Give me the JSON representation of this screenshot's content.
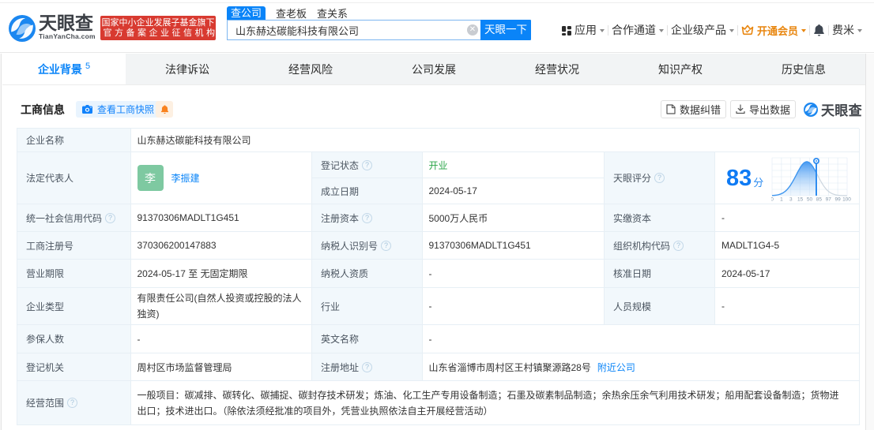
{
  "brand": {
    "name": "天眼查",
    "domain": "TianYanCha.com",
    "badge_line1": "国家中小企业发展子基金旗下",
    "badge_line2": "官方备案企业征信机构",
    "colors": {
      "blue": "#0a84f8",
      "red": "#d83a30",
      "orange": "#e8860f",
      "green": "#2aa548"
    }
  },
  "search": {
    "tab_company": "查公司",
    "tab_boss": "查老板",
    "tab_relation": "查关系",
    "value": "山东赫达碳能科技有限公司",
    "button": "天眼一下"
  },
  "nav": {
    "apps": "应用",
    "partner": "合作通道",
    "enterprise": "企业级产品",
    "vip": "开通会员",
    "user": "费米"
  },
  "tabs": {
    "t0": {
      "label": "企业背景",
      "count": "5"
    },
    "t1": {
      "label": "法律诉讼"
    },
    "t2": {
      "label": "经营风险"
    },
    "t3": {
      "label": "公司发展"
    },
    "t4": {
      "label": "经营状况"
    },
    "t5": {
      "label": "知识产权"
    },
    "t6": {
      "label": "历史信息"
    }
  },
  "section": {
    "title": "工商信息",
    "snapshot": "查看工商快照",
    "correct": "数据纠错",
    "export": "导出数据",
    "watermark": "天眼查"
  },
  "table": {
    "r1": {
      "label": "企业名称",
      "value": "山东赫达碳能科技有限公司"
    },
    "r2": {
      "label": "法定代表人",
      "avatar": "李",
      "person": "李振建",
      "c1_label": "登记状态",
      "c1_value": "开业",
      "c2_label": "成立日期",
      "c2_value": "2024-05-17",
      "score_label": "天眼评分",
      "score": "83",
      "score_unit": "分"
    },
    "r3": {
      "l1": "统一社会信用代码",
      "v1": "91370306MADLT1G451",
      "l2": "注册资本",
      "v2": "5000万人民币",
      "l3": "实缴资本",
      "v3": "-"
    },
    "r4": {
      "l1": "工商注册号",
      "v1": "370306200147883",
      "l2": "纳税人识别号",
      "v2": "91370306MADLT1G451",
      "l3": "组织机构代码",
      "v3": "MADLT1G4-5"
    },
    "r5": {
      "l1": "营业期限",
      "v1": "2024-05-17 至 无固定期限",
      "l2": "纳税人资质",
      "v2": "-",
      "l3": "核准日期",
      "v3": "2024-05-17"
    },
    "r6": {
      "l1": "企业类型",
      "v1": "有限责任公司(自然人投资或控股的法人独资)",
      "l2": "行业",
      "v2": "-",
      "l3": "人员规模",
      "v3": "-"
    },
    "r7": {
      "l1": "参保人数",
      "v1": "-",
      "l2": "英文名称",
      "v2": "-"
    },
    "r8": {
      "l1": "登记机关",
      "v1": "周村区市场监督管理局",
      "l2": "注册地址",
      "v2": "山东省淄博市周村区王村镇聚源路28号",
      "v2_link": "附近公司"
    },
    "r9": {
      "label": "经营范围",
      "value": "一般项目：碳减排、碳转化、碳捕捉、碳封存技术研发；炼油、化工生产专用设备制造；石墨及碳素制品制造；余热余压余气利用技术研发；船用配套设备制造；货物进出口；技术进出口。（除依法须经批准的项目外，凭营业执照依法自主开展经营活动）"
    }
  },
  "chart_data": {
    "type": "line",
    "title": "天眼评分",
    "score": 83,
    "unit": "分",
    "x_ticks": [
      "0",
      "1",
      "3",
      "15",
      "50",
      "85",
      "97",
      "99",
      "100"
    ],
    "curve": "percentile bell curve with marker pin at score 83",
    "marker_value": 83,
    "grid": true
  }
}
